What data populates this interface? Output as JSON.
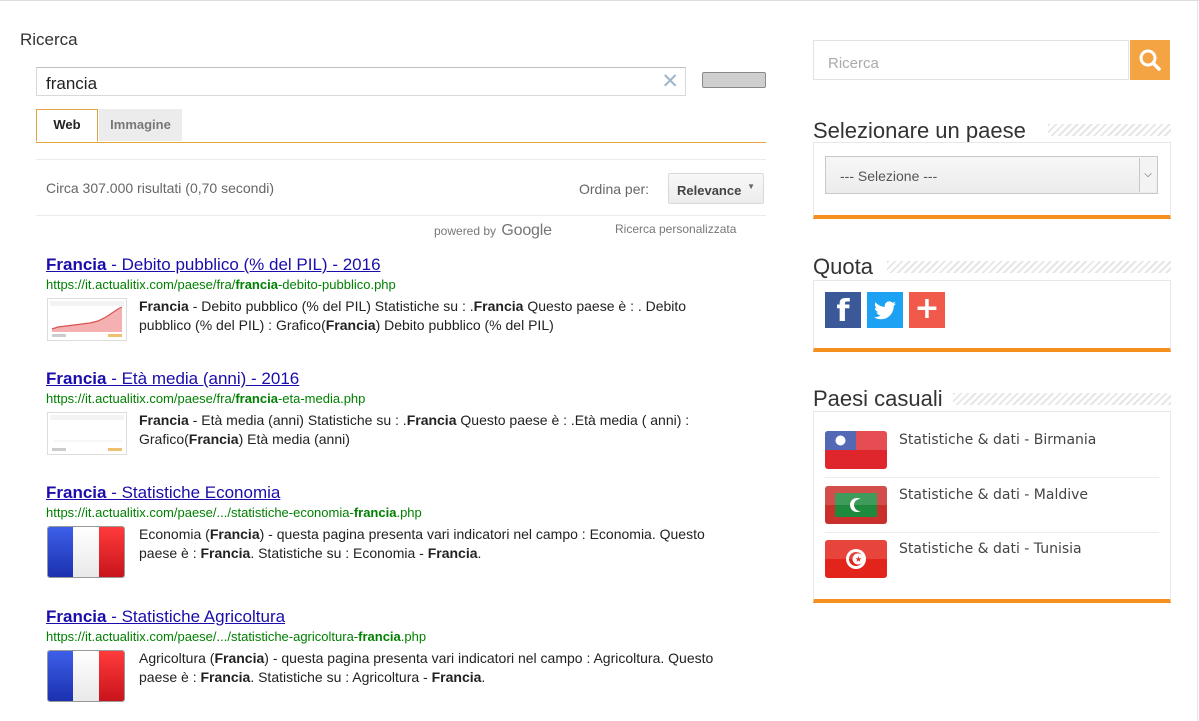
{
  "page": {
    "heading": "Ricerca"
  },
  "search": {
    "query": "francia",
    "clear_glyph": "✕",
    "tabs": [
      {
        "label": "Web"
      },
      {
        "label": "Immagine"
      }
    ]
  },
  "results_bar": {
    "info": "Circa 307.000 risultati (0,70 secondi)",
    "order_label": "Ordina per:",
    "order_value": "Relevance"
  },
  "branding": {
    "powered_by": "powered by",
    "google": "Google",
    "custom_search": "Ricerca personalizzata"
  },
  "results": [
    {
      "title_bold": "Francia",
      "title_rest": " - Debito pubblico (% del PIL) - 2016",
      "url_pre": "https://it.actualitix.com/paese/fra/",
      "url_bold": "francia",
      "url_post": "-debito-pubblico.php",
      "snippet": [
        {
          "b": true,
          "t": "Francia"
        },
        {
          "b": false,
          "t": " - Debito pubblico (% del PIL) Statistiche su : ."
        },
        {
          "b": true,
          "t": "Francia"
        },
        {
          "b": false,
          "t": " Questo paese è : . Debito pubblico (% del PIL) : Grafico("
        },
        {
          "b": true,
          "t": "Francia"
        },
        {
          "b": false,
          "t": ") Debito pubblico (% del PIL)"
        }
      ]
    },
    {
      "title_bold": "Francia",
      "title_rest": " - Età media (anni) - 2016",
      "url_pre": "https://it.actualitix.com/paese/fra/",
      "url_bold": "francia",
      "url_post": "-eta-media.php",
      "snippet": [
        {
          "b": true,
          "t": "Francia"
        },
        {
          "b": false,
          "t": " - Età media (anni) Statistiche su : ."
        },
        {
          "b": true,
          "t": "Francia"
        },
        {
          "b": false,
          "t": " Questo paese è : .Età media ( anni) : Grafico("
        },
        {
          "b": true,
          "t": "Francia"
        },
        {
          "b": false,
          "t": ") Età media (anni)"
        }
      ]
    },
    {
      "title_bold": "Francia",
      "title_rest": " - Statistiche Economia",
      "url_pre": "https://it.actualitix.com/paese/.../statistiche-economia-",
      "url_bold": "francia",
      "url_post": ".php",
      "snippet": [
        {
          "b": false,
          "t": "Economia ("
        },
        {
          "b": true,
          "t": "Francia"
        },
        {
          "b": false,
          "t": ") - questa pagina presenta vari indicatori nel campo : Economia. Questo paese è : "
        },
        {
          "b": true,
          "t": "Francia"
        },
        {
          "b": false,
          "t": ". Statistiche su : Economia - "
        },
        {
          "b": true,
          "t": "Francia"
        },
        {
          "b": false,
          "t": "."
        }
      ]
    },
    {
      "title_bold": "Francia",
      "title_rest": " - Statistiche Agricoltura",
      "url_pre": "https://it.actualitix.com/paese/.../statistiche-agricoltura-",
      "url_bold": "francia",
      "url_post": ".php",
      "snippet": [
        {
          "b": false,
          "t": "Agricoltura ("
        },
        {
          "b": true,
          "t": "Francia"
        },
        {
          "b": false,
          "t": ") - questa pagina presenta vari indicatori nel campo : Agricoltura. Questo paese è : "
        },
        {
          "b": true,
          "t": "Francia"
        },
        {
          "b": false,
          "t": ". Statistiche su : Agricoltura - "
        },
        {
          "b": true,
          "t": "Francia"
        },
        {
          "b": false,
          "t": "."
        }
      ]
    }
  ],
  "sidebar": {
    "search_placeholder": "Ricerca",
    "search_icon": "magnifier-icon",
    "country_title": "Selezionare un paese",
    "country_select": "--- Selezione ---",
    "share_title": "Quota",
    "share_buttons": [
      "facebook-icon",
      "twitter-icon",
      "plus-icon"
    ],
    "random_title": "Paesi casuali",
    "random_countries": [
      {
        "label": "Statistiche & dati - Birmania"
      },
      {
        "label": "Statistiche & dati - Maldive"
      },
      {
        "label": "Statistiche & dati - Tunisia"
      }
    ]
  },
  "colors": {
    "accent_orange": "#f5901e",
    "search_btn": "#f5a443",
    "link_blue": "#1a0dab",
    "url_green": "#008000",
    "france_blue": "#1d3ec9",
    "france_red": "#e8242b"
  }
}
